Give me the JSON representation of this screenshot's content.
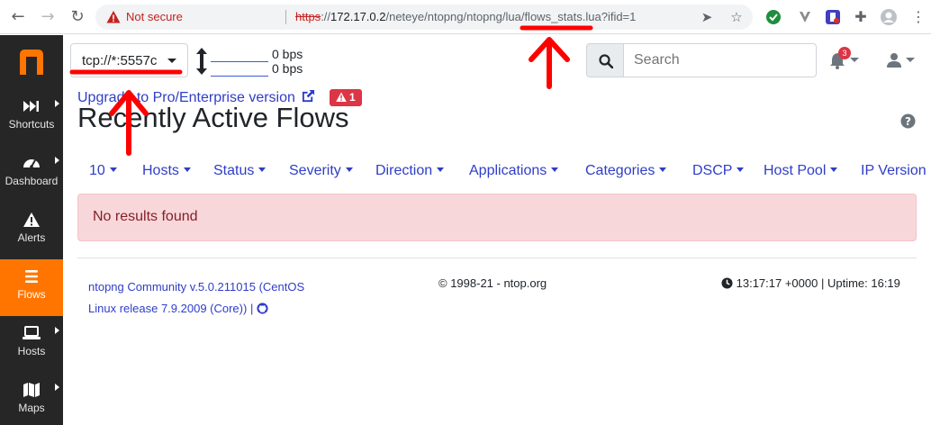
{
  "browser": {
    "security_label": "Not secure",
    "url_scheme": "https",
    "url_separator": "://",
    "url_host": "172.17.0.2",
    "url_path": "/neteye/ntopng/ntopng/lua/flows_stats.lua?ifid=1"
  },
  "sidebar": {
    "logo": "n",
    "items": [
      {
        "label": "Shortcuts",
        "icon": "fast-forward-icon",
        "has_submenu": true
      },
      {
        "label": "Dashboard",
        "icon": "gauge-icon",
        "has_submenu": true
      },
      {
        "label": "Alerts",
        "icon": "warning-icon",
        "has_submenu": false
      },
      {
        "label": "Flows",
        "icon": "list-icon",
        "has_submenu": false,
        "active": true
      },
      {
        "label": "Hosts",
        "icon": "laptop-icon",
        "has_submenu": true
      },
      {
        "label": "Maps",
        "icon": "map-icon",
        "has_submenu": true
      }
    ]
  },
  "topbar": {
    "interface": "tcp://*:5557c",
    "upload_rate": "0 bps",
    "download_rate": "0 bps",
    "search_placeholder": "Search",
    "notification_count": "3"
  },
  "main": {
    "upgrade_link": "Upgrade to Pro/Enterprise version",
    "alert_count": "1",
    "title": "Recently Active Flows",
    "filters": [
      "10",
      "Hosts",
      "Status",
      "Severity",
      "Direction",
      "Applications",
      "Categories",
      "DSCP",
      "Host Pool",
      "IP Version"
    ],
    "no_results": "No results found"
  },
  "footer": {
    "version_line1": "ntopng Community v.5.0.211015 (CentOS",
    "version_line2": "Linux release 7.9.2009 (Core))",
    "version_sep": " | ",
    "copyright": "© 1998-21 - ntop.org",
    "clock": "13:17:17 +0000",
    "uptime": " | Uptime: 16:19"
  },
  "colors": {
    "sidebar_bg": "#262626",
    "sidebar_active": "#ff7500",
    "link": "#2f3dc7",
    "danger": "#dc3545",
    "annotation": "#ff0000"
  }
}
